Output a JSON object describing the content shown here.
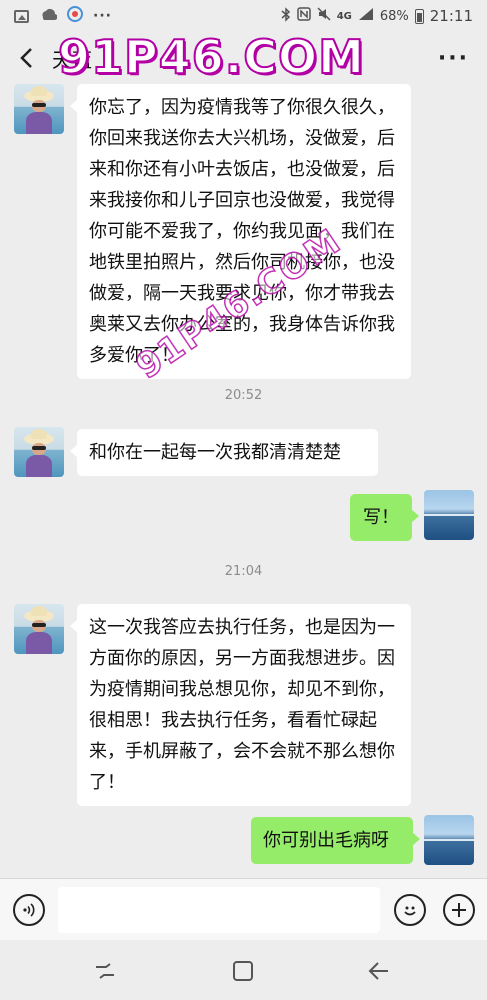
{
  "status_bar": {
    "signal_text": "4G",
    "battery": "68%",
    "time": "21:11",
    "icons": [
      "image-icon",
      "weather-icon",
      "app-icon",
      "more-dots-icon",
      "bluetooth-icon",
      "nfc-icon",
      "mute-icon",
      "signal-icon",
      "battery-icon"
    ]
  },
  "header": {
    "title": "天蓝",
    "watermark": "91P46.COM",
    "back_icon": "back-arrow-icon",
    "more_icon": "more-icon"
  },
  "watermark_diag": "91P46.COM",
  "messages": [
    {
      "side": "left",
      "text": "你忘了，因为疫情我等了你很久很久，你回来我送你去大兴机场，没做爱，后来和你还有小叶去饭店，也没做爱，后来我接你和儿子回京也没做爱，我觉得你可能不爱我了，你约我见面，我们在地铁里拍照片，然后你司机接你，也没做爱，隔一天我要求见你，你才带我去奥莱又去你办公室的，我身体告诉你我多爱你了！"
    },
    {
      "type": "time",
      "text": "20:52"
    },
    {
      "side": "left",
      "text": "和你在一起每一次我都清清楚楚"
    },
    {
      "side": "right",
      "text": "写！"
    },
    {
      "type": "time",
      "text": "21:04"
    },
    {
      "side": "left",
      "text": "这一次我答应去执行任务，也是因为一方面你的原因，另一方面我想进步。因为疫情期间我总想见你，却见不到你，很相思！我去执行任务，看看忙碌起来，手机屏蔽了，会不会就不那么想你了！"
    },
    {
      "side": "right",
      "text": "你可别出毛病呀"
    }
  ],
  "input_bar": {
    "placeholder": "",
    "voice_icon": "voice-icon",
    "emoji_icon": "emoji-icon",
    "plus_icon": "plus-icon"
  },
  "nav_bar": {
    "icons": [
      "recents-icon",
      "home-icon",
      "back-icon"
    ]
  },
  "colors": {
    "background": "#ededed",
    "bubble_left": "#ffffff",
    "bubble_right": "#95ec69",
    "timestamp": "#8c8c8c",
    "watermark": "#b300a5"
  }
}
